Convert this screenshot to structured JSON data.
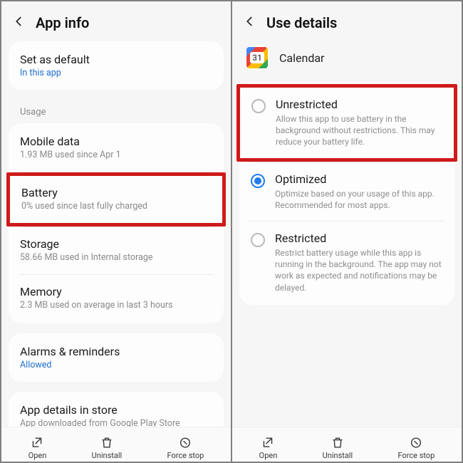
{
  "left": {
    "title": "App info",
    "set_default_title": "Set as default",
    "set_default_link": "In this app",
    "usage_label": "Usage",
    "mobile_data_title": "Mobile data",
    "mobile_data_sub": "1.93 MB used since Apr 1",
    "battery_title": "Battery",
    "battery_sub": "0% used since last fully charged",
    "storage_title": "Storage",
    "storage_sub": "58.66 MB used in Internal storage",
    "memory_title": "Memory",
    "memory_sub": "2.3 MB used on average in last 3 hours",
    "alarms_title": "Alarms & reminders",
    "alarms_link": "Allowed",
    "store_title": "App details in store",
    "store_sub": "App downloaded from Google Play Store",
    "bottom": {
      "open": "Open",
      "uninstall": "Uninstall",
      "force": "Force stop"
    }
  },
  "right": {
    "title": "Use details",
    "app_name": "Calendar",
    "app_badge": "31",
    "unrestricted_title": "Unrestricted",
    "unrestricted_desc": "Allow this app to use battery in the background without restrictions. This may reduce your battery life.",
    "optimized_title": "Optimized",
    "optimized_desc": "Optimize based on your usage of this app. Recommended for most apps.",
    "restricted_title": "Restricted",
    "restricted_desc": "Restrict battery usage while this app is running in the background. The app may not work as expected and notifications may be delayed.",
    "bottom": {
      "open": "Open",
      "uninstall": "Uninstall",
      "force": "Force stop"
    }
  }
}
